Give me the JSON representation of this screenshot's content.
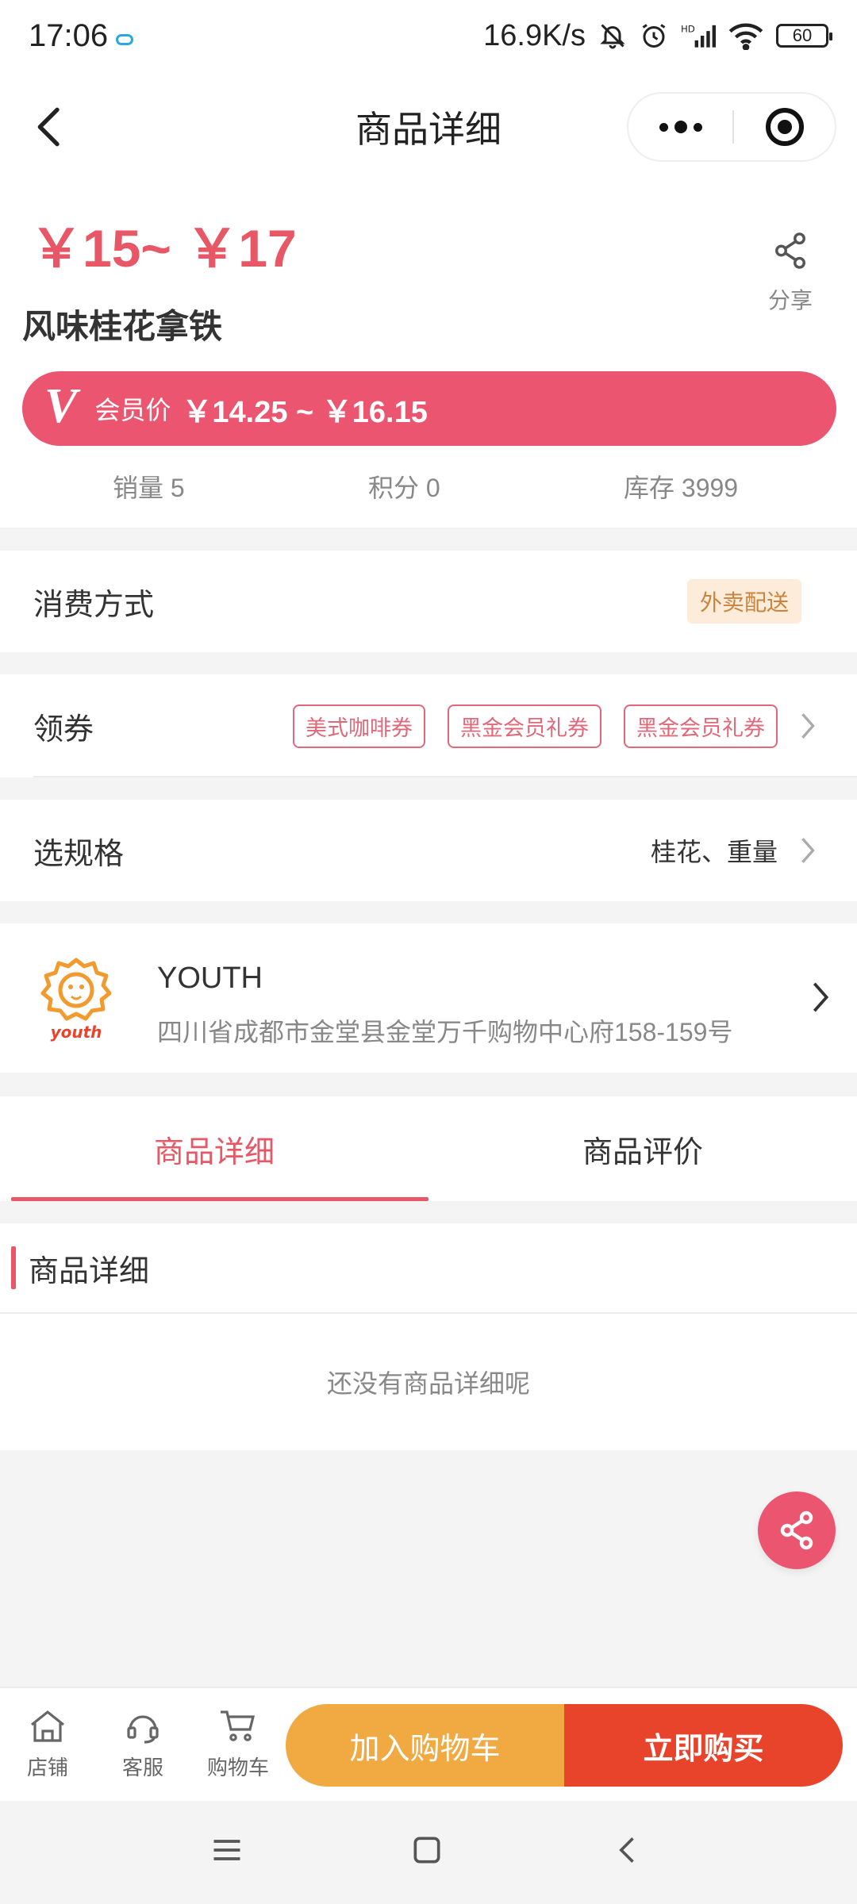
{
  "status_bar": {
    "time": "17:06",
    "net_speed": "16.9K/s",
    "signal": "HD",
    "battery": "60"
  },
  "nav": {
    "title": "商品详细"
  },
  "product": {
    "price_range": "￥15~ ￥17",
    "name": "风味桂花拿铁",
    "share_label": "分享",
    "vip_icon": "V",
    "vip_label": "会员价",
    "vip_price": "￥14.25 ~ ￥16.15",
    "stats": {
      "sales": "销量 5",
      "points": "积分 0",
      "stock": "库存 3999"
    }
  },
  "consume": {
    "label": "消费方式",
    "tag": "外卖配送"
  },
  "coupon": {
    "label": "领券",
    "tags": [
      "美式咖啡券",
      "黑金会员礼券",
      "黑金会员礼券"
    ]
  },
  "spec": {
    "label": "选规格",
    "value": "桂花、重量"
  },
  "store": {
    "logo_text": "youth",
    "name": "YOUTH",
    "address": "四川省成都市金堂县金堂万千购物中心府158-159号"
  },
  "tabs": [
    {
      "label": "商品详细"
    },
    {
      "label": "商品评价"
    }
  ],
  "detail": {
    "title": "商品详细",
    "empty": "还没有商品详细呢"
  },
  "bottom_bar": {
    "shop": "店铺",
    "service": "客服",
    "cart": "购物车",
    "add_to_cart": "加入购物车",
    "buy_now": "立即购买"
  },
  "colors": {
    "accent": "#e85766",
    "vip_bar": "#ec5570",
    "cart_btn": "#f1aa42",
    "buy_btn": "#e8442c"
  }
}
